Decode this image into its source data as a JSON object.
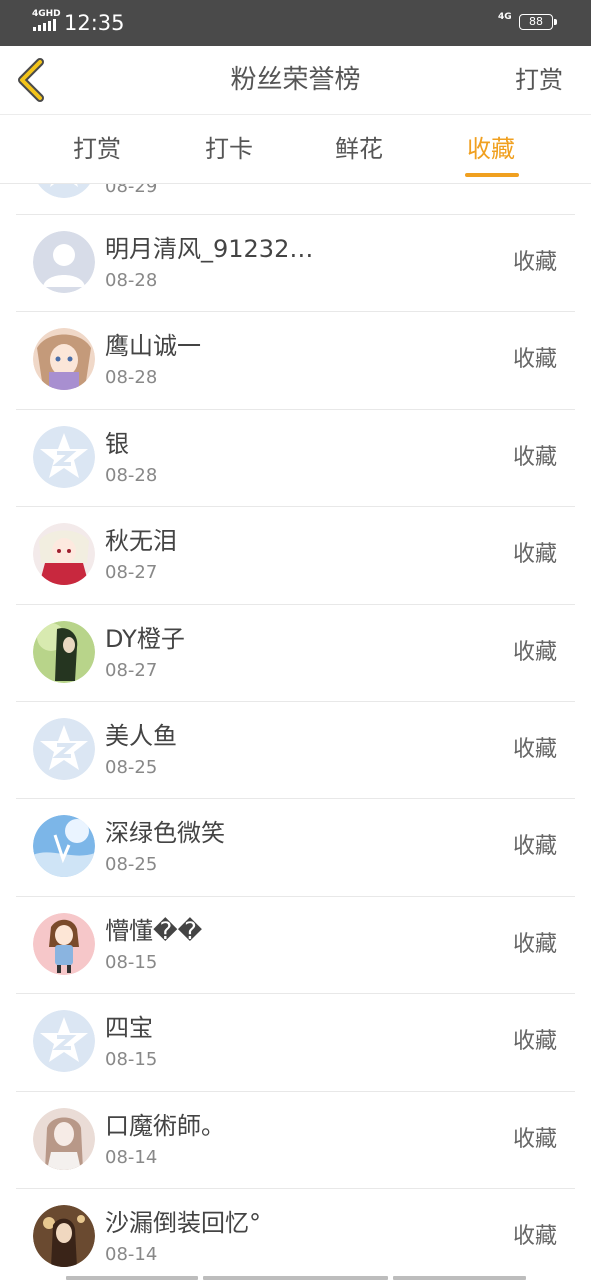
{
  "status": {
    "network": "4GHD",
    "time": "12:35",
    "network2": "4G",
    "battery": "88"
  },
  "header": {
    "title": "粉丝荣誉榜",
    "action": "打赏"
  },
  "tabs": [
    "打赏",
    "打卡",
    "鲜花",
    "收藏"
  ],
  "active_tab": "收藏",
  "partial_item": {
    "date": "08-29"
  },
  "items": [
    {
      "name": "明月清风_91232…",
      "date": "08-28",
      "action": "收藏"
    },
    {
      "name": "鹰山诚一",
      "date": "08-28",
      "action": "收藏"
    },
    {
      "name": "银",
      "date": "08-28",
      "action": "收藏"
    },
    {
      "name": "秋无泪",
      "date": "08-27",
      "action": "收藏"
    },
    {
      "name": "DY橙子",
      "date": "08-27",
      "action": "收藏"
    },
    {
      "name": "美人鱼",
      "date": "08-25",
      "action": "收藏"
    },
    {
      "name": "深绿色微笑",
      "date": "08-25",
      "action": "收藏"
    },
    {
      "name": "懵懂��",
      "date": "08-15",
      "action": "收藏"
    },
    {
      "name": "四宝",
      "date": "08-15",
      "action": "收藏"
    },
    {
      "name": "口魔術師。",
      "date": "08-14",
      "action": "收藏"
    },
    {
      "name": "沙漏倒装回忆°",
      "date": "08-14",
      "action": "收藏"
    }
  ],
  "colors": {
    "accent": "#f0a020",
    "statusbar": "#4a4a4a",
    "divider": "#e8e8e8"
  }
}
